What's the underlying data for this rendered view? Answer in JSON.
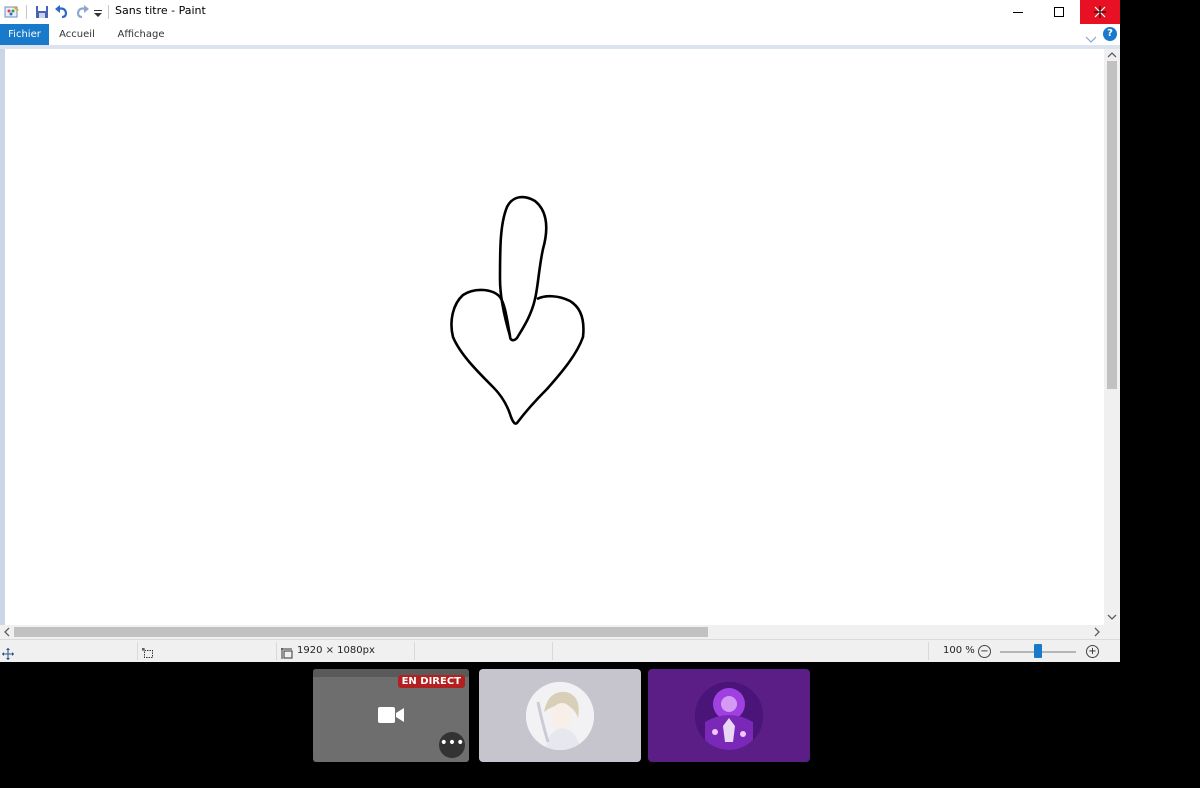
{
  "window": {
    "title": "Sans titre - Paint",
    "accent_color": "#1979ca",
    "close_color": "#e81123"
  },
  "quick_access": {
    "icons": [
      "paint-app-icon",
      "save-icon",
      "undo-icon",
      "redo-icon",
      "customize-dropdown-icon"
    ]
  },
  "tabs": [
    {
      "label": "Fichier",
      "active": true
    },
    {
      "label": "Accueil",
      "active": false
    },
    {
      "label": "Affichage",
      "active": false
    }
  ],
  "statusbar": {
    "image_size": "1920 × 1080px",
    "zoom_level": "100 %",
    "zoom_fraction": 0.5
  },
  "taskbar": {
    "live_badge": "EN DIRECT",
    "more_glyph": "•••"
  }
}
